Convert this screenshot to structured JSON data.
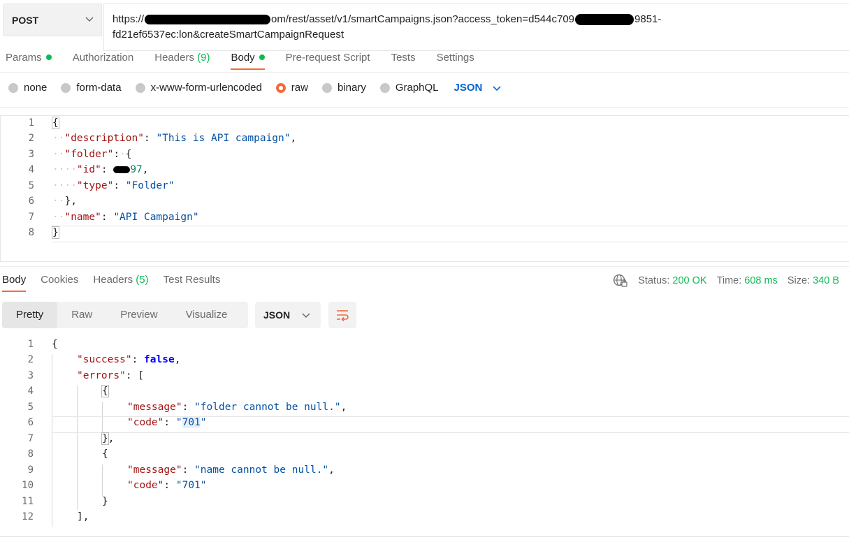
{
  "request": {
    "method": "POST",
    "url_part1": "https://",
    "url_part2": "om/rest/asset/v1/smartCampaigns.json?access_token=d544c709",
    "url_part3": "9851-",
    "url_line2": "fd21ef6537ec:lon&createSmartCampaignRequest"
  },
  "request_tabs": [
    {
      "label": "Params",
      "dot": true
    },
    {
      "label": "Authorization"
    },
    {
      "label": "Headers",
      "count": "(9)"
    },
    {
      "label": "Body",
      "dot": true,
      "active": true
    },
    {
      "label": "Pre-request Script"
    },
    {
      "label": "Tests"
    },
    {
      "label": "Settings"
    }
  ],
  "body_types": [
    "none",
    "form-data",
    "x-www-form-urlencoded",
    "raw",
    "binary",
    "GraphQL"
  ],
  "body_type_selected": "raw",
  "body_language": "JSON",
  "request_body": {
    "line_numbers": [
      "1",
      "2",
      "3",
      "4",
      "5",
      "6",
      "7",
      "8"
    ],
    "description_key": "\"description\"",
    "description_val": "\"This is API campaign\"",
    "folder_key": "\"folder\"",
    "id_key": "\"id\"",
    "id_val_visible": "97",
    "type_key": "\"type\"",
    "type_val": "\"Folder\"",
    "name_key": "\"name\"",
    "name_val": "\"API Campaign\""
  },
  "response_tabs": [
    {
      "label": "Body",
      "active": true
    },
    {
      "label": "Cookies"
    },
    {
      "label": "Headers",
      "count": "(5)"
    },
    {
      "label": "Test Results"
    }
  ],
  "response_status": {
    "status_label": "Status:",
    "status": "200 OK",
    "time_label": "Time:",
    "time": "608 ms",
    "size_label": "Size:",
    "size": "340 B"
  },
  "response_formats": [
    "Pretty",
    "Raw",
    "Preview",
    "Visualize"
  ],
  "response_format_selected": "Pretty",
  "response_language": "JSON",
  "response_body": {
    "line_numbers": [
      "1",
      "2",
      "3",
      "4",
      "5",
      "6",
      "7",
      "8",
      "9",
      "10",
      "11",
      "12"
    ],
    "success_key": "\"success\"",
    "success_val": "false",
    "errors_key": "\"errors\"",
    "message_key": "\"message\"",
    "code_key": "\"code\"",
    "msg1": "\"folder cannot be null.\"",
    "msg2": "\"name cannot be null.\"",
    "code1_q": "\"",
    "code1_n": "701",
    "code2_n": "701"
  },
  "colors": {
    "accent": "#f26b3a",
    "success_green": "#0cbb52",
    "link_blue": "#0265d2",
    "json_key": "#a31515",
    "json_string": "#0451a5",
    "json_keyword": "#0000ff"
  }
}
